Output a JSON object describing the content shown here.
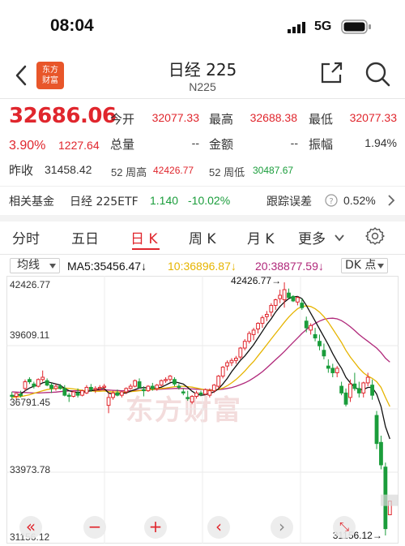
{
  "status_bar": {
    "time": "08:04",
    "network": "5G"
  },
  "header": {
    "logo_line1": "东方",
    "logo_line2": "财富",
    "title": "日经 225",
    "subtitle": "N225"
  },
  "quote": {
    "price": "32686.06",
    "change_pct": "3.90%",
    "change_val": "1227.64",
    "open_label": "今开",
    "open": "32077.33",
    "high_label": "最高",
    "high": "32688.38",
    "low_label": "最低",
    "low": "32077.33",
    "volume_label": "总量",
    "volume": "--",
    "amount_label": "金额",
    "amount": "--",
    "amplitude_label": "振幅",
    "amplitude": "1.94%",
    "prev_close_label": "昨收",
    "prev_close": "31458.42",
    "w52_high_label": "52 周高",
    "w52_high": "42426.77",
    "w52_low_label": "52 周低",
    "w52_low": "30487.67"
  },
  "fund": {
    "label": "相关基金",
    "name": "日经 225ETF",
    "price": "1.140",
    "change": "-10.02%",
    "track_label": "跟踪误差",
    "track_val": "0.52%"
  },
  "tabs": [
    {
      "label": "分时"
    },
    {
      "label": "五日"
    },
    {
      "label": "日 K"
    },
    {
      "label": "周 K"
    },
    {
      "label": "月 K"
    },
    {
      "label": "更多"
    }
  ],
  "ma_bar": {
    "type": "均线",
    "ma5": "MA5:35456.47↓",
    "ma10": "10:36896.87↓",
    "ma20": "20:38877.59↓",
    "kind": "DK 点"
  },
  "colors": {
    "up": "#e0262d",
    "down": "#1a9d3b",
    "ma5": "#111111",
    "ma10": "#e6b400",
    "ma20": "#b0287a"
  },
  "icons": [
    "back-icon",
    "share-icon",
    "search-icon",
    "help-icon",
    "chevron-right-icon",
    "settings-icon"
  ],
  "watermark": "东方财富",
  "controls": [
    "«",
    "−",
    "+",
    "‹",
    "›",
    "⤡"
  ],
  "chart_data": {
    "type": "candlestick",
    "y_ticks": [
      "42426.77",
      "39609.11",
      "36791.45",
      "33973.78",
      "31156.12"
    ],
    "ylim": [
      31156.12,
      42426.77
    ],
    "annotations": {
      "max": "42426.77→",
      "min": "31156.12→"
    },
    "candles": [
      [
        37400,
        37550,
        37250,
        37350
      ],
      [
        37350,
        37500,
        37200,
        37480
      ],
      [
        37450,
        37600,
        37300,
        37380
      ],
      [
        37700,
        38100,
        37600,
        38000
      ],
      [
        38100,
        38200,
        37900,
        38000
      ],
      [
        37900,
        38000,
        37700,
        37800
      ],
      [
        37800,
        38150,
        37750,
        38100
      ],
      [
        38100,
        38500,
        38000,
        38200
      ],
      [
        38050,
        38150,
        37800,
        37850
      ],
      [
        37850,
        37950,
        37500,
        37700
      ],
      [
        37700,
        37900,
        37600,
        37800
      ],
      [
        37800,
        37900,
        37650,
        37700
      ],
      [
        37700,
        37850,
        37350,
        37400
      ],
      [
        37400,
        37500,
        37100,
        37350
      ],
      [
        37350,
        37600,
        37300,
        37550
      ],
      [
        37500,
        37700,
        37300,
        37400
      ],
      [
        37400,
        37650,
        37350,
        37600
      ],
      [
        37500,
        37850,
        37450,
        37750
      ],
      [
        37750,
        37900,
        37550,
        37650
      ],
      [
        37650,
        37800,
        37500,
        37700
      ],
      [
        37700,
        37850,
        37600,
        37750
      ],
      [
        37750,
        37900,
        37600,
        37800
      ],
      [
        36950,
        37500,
        36600,
        37300
      ],
      [
        37300,
        37600,
        37200,
        37500
      ],
      [
        37500,
        37650,
        37350,
        37400
      ],
      [
        37400,
        37600,
        37300,
        37550
      ],
      [
        37550,
        37750,
        37450,
        37700
      ],
      [
        37700,
        37900,
        37650,
        37800
      ],
      [
        37800,
        38100,
        37750,
        38050
      ],
      [
        38000,
        38150,
        37700,
        37750
      ],
      [
        37650,
        37800,
        37350,
        37600
      ],
      [
        37600,
        37850,
        37550,
        37800
      ],
      [
        37800,
        37950,
        37600,
        37700
      ],
      [
        37700,
        37900,
        37600,
        37850
      ],
      [
        37850,
        38100,
        37800,
        38050
      ],
      [
        38050,
        38200,
        37950,
        38100
      ],
      [
        38100,
        38300,
        38000,
        38250
      ],
      [
        38100,
        38200,
        37800,
        37900
      ],
      [
        37800,
        37900,
        37650,
        37750
      ],
      [
        37550,
        37700,
        37400,
        37500
      ],
      [
        37300,
        37600,
        37150,
        37250
      ],
      [
        37100,
        37400,
        37000,
        37350
      ],
      [
        37350,
        37600,
        37250,
        37500
      ],
      [
        37500,
        37600,
        37350,
        37450
      ],
      [
        37450,
        37700,
        37400,
        37650
      ],
      [
        37400,
        37700,
        37300,
        37600
      ],
      [
        37600,
        37900,
        37500,
        37850
      ],
      [
        37800,
        38300,
        37700,
        38250
      ],
      [
        38250,
        38700,
        38150,
        38650
      ],
      [
        38700,
        38950,
        38500,
        38850
      ],
      [
        38850,
        39050,
        38700,
        38950
      ],
      [
        38950,
        39150,
        38800,
        39050
      ],
      [
        39100,
        39550,
        39000,
        39500
      ],
      [
        39500,
        39900,
        39400,
        39800
      ],
      [
        39800,
        40250,
        39700,
        40150
      ],
      [
        40100,
        40400,
        39850,
        40300
      ],
      [
        40350,
        40650,
        40150,
        40600
      ],
      [
        40600,
        40950,
        40400,
        40850
      ],
      [
        40900,
        41150,
        40700,
        41000
      ],
      [
        41100,
        41500,
        40900,
        41400
      ],
      [
        41400,
        41700,
        41200,
        41650
      ],
      [
        41700,
        42100,
        41500,
        41850
      ],
      [
        41650,
        42426.77,
        41300,
        42100
      ],
      [
        41950,
        42150,
        41700,
        41750
      ],
      [
        41800,
        41850,
        41550,
        41600
      ],
      [
        41550,
        41800,
        41400,
        41750
      ],
      [
        41500,
        41700,
        41200,
        41300
      ],
      [
        40700,
        40900,
        40200,
        40400
      ],
      [
        40300,
        40600,
        40100,
        40500
      ],
      [
        40100,
        40400,
        39800,
        39950
      ],
      [
        39800,
        40100,
        39400,
        39600
      ],
      [
        39400,
        39700,
        39000,
        39150
      ],
      [
        38700,
        39000,
        38400,
        38600
      ],
      [
        38600,
        38800,
        38200,
        38400
      ],
      [
        38400,
        38700,
        38200,
        38600
      ],
      [
        37800,
        38000,
        37400,
        37500
      ],
      [
        37500,
        37700,
        36900,
        37000
      ],
      [
        37300,
        38100,
        37100,
        37900
      ],
      [
        37900,
        38400,
        37600,
        37700
      ],
      [
        37700,
        38000,
        37300,
        37500
      ],
      [
        37500,
        38000,
        37300,
        37950
      ],
      [
        37950,
        38400,
        37800,
        38200
      ],
      [
        37850,
        38100,
        37200,
        37400
      ],
      [
        36500,
        36700,
        35000,
        35250
      ],
      [
        35300,
        35600,
        34100,
        34300
      ],
      [
        34200,
        34400,
        31156.12,
        31458.42
      ],
      [
        32077.33,
        32688.38,
        32077.33,
        32686.06
      ]
    ],
    "ma5": [
      37350,
      37380,
      37450,
      37600,
      37720,
      37800,
      37850,
      37950,
      38000,
      37950,
      37900,
      37850,
      37700,
      37600,
      37550,
      37520,
      37540,
      37560,
      37600,
      37630,
      37680,
      37700,
      37500,
      37450,
      37450,
      37480,
      37500,
      37580,
      37650,
      37720,
      37740,
      37720,
      37700,
      37720,
      37760,
      37850,
      37950,
      38000,
      37950,
      37900,
      37750,
      37580,
      37450,
      37400,
      37420,
      37480,
      37550,
      37680,
      37900,
      38150,
      38450,
      38700,
      38950,
      39150,
      39400,
      39650,
      39950,
      40250,
      40550,
      40800,
      41100,
      41350,
      41550,
      41700,
      41780,
      41800,
      41700,
      41400,
      41050,
      40700,
      40350,
      40000,
      39650,
      39250,
      38900,
      38600,
      38200,
      37950,
      37750,
      37650,
      37650,
      37750,
      37750,
      37450,
      36900,
      36000,
      35456.47
    ],
    "ma10": [
      37300,
      37320,
      37340,
      37380,
      37420,
      37480,
      37540,
      37600,
      37650,
      37680,
      37700,
      37720,
      37720,
      37700,
      37680,
      37650,
      37620,
      37600,
      37590,
      37580,
      37580,
      37590,
      37560,
      37550,
      37550,
      37540,
      37540,
      37560,
      37580,
      37600,
      37620,
      37650,
      37660,
      37680,
      37700,
      37720,
      37750,
      37780,
      37800,
      37800,
      37780,
      37760,
      37720,
      37680,
      37640,
      37620,
      37620,
      37660,
      37720,
      37820,
      37950,
      38100,
      38280,
      38480,
      38700,
      38900,
      39150,
      39400,
      39650,
      39900,
      40150,
      40400,
      40650,
      40880,
      41080,
      41250,
      41350,
      41380,
      41350,
      41250,
      41100,
      40900,
      40650,
      40350,
      40050,
      39750,
      39400,
      39100,
      38850,
      38600,
      38400,
      38250,
      38150,
      38000,
      37750,
      37300,
      36896.87
    ],
    "ma20": [
      37550,
      37540,
      37530,
      37520,
      37510,
      37500,
      37500,
      37510,
      37520,
      37530,
      37540,
      37560,
      37580,
      37590,
      37600,
      37600,
      37600,
      37600,
      37610,
      37620,
      37630,
      37640,
      37630,
      37620,
      37610,
      37600,
      37600,
      37600,
      37610,
      37620,
      37630,
      37640,
      37650,
      37660,
      37670,
      37680,
      37690,
      37700,
      37700,
      37700,
      37690,
      37680,
      37670,
      37660,
      37650,
      37640,
      37640,
      37650,
      37670,
      37700,
      37740,
      37800,
      37870,
      37950,
      38050,
      38170,
      38300,
      38450,
      38620,
      38800,
      38980,
      39160,
      39350,
      39550,
      39750,
      39950,
      40150,
      40320,
      40470,
      40600,
      40700,
      40780,
      40820,
      40830,
      40800,
      40720,
      40600,
      40450,
      40280,
      40100,
      39950,
      39800,
      39650,
      39500,
      39300,
      39050,
      38877.59
    ]
  }
}
